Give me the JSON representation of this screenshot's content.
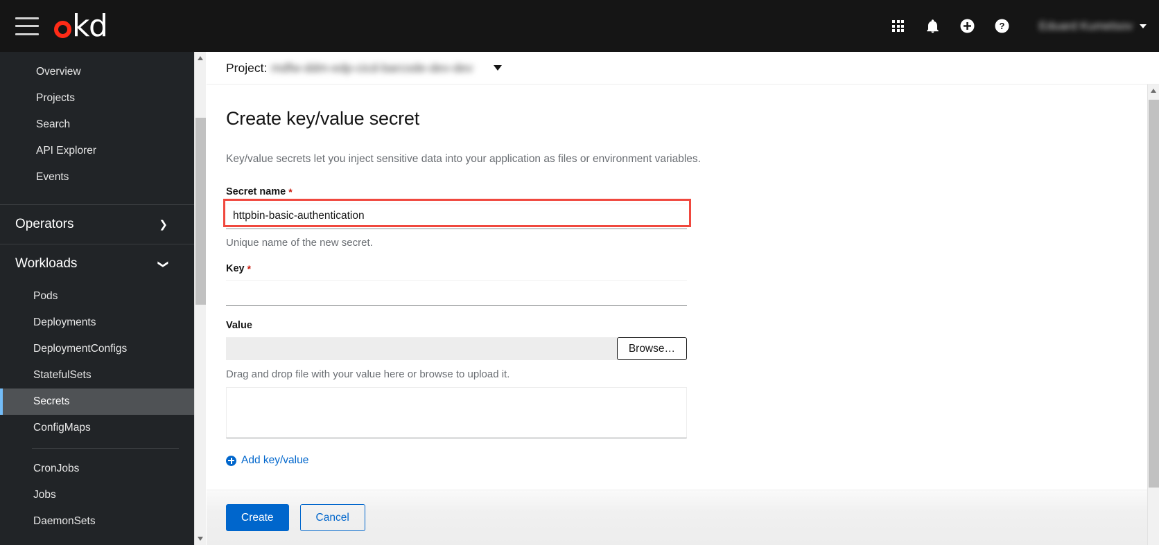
{
  "masthead": {
    "brand": "okd",
    "brand_prefix": "o",
    "brand_suffix": "kd",
    "hamburger_icon": "hamburger-menu-icon",
    "apps_icon": "apps-grid-icon",
    "bell_icon": "notification-bell-icon",
    "plus_icon": "plus-circle-icon",
    "help_icon": "help-circle-icon",
    "user_name": "Eduard Kumetsov",
    "accent_red": "#ff2b17",
    "background": "#151515"
  },
  "sidebar": {
    "items": [
      {
        "label": "Overview",
        "type": "link",
        "active": false
      },
      {
        "label": "Projects",
        "type": "link",
        "active": false
      },
      {
        "label": "Search",
        "type": "link",
        "active": false
      },
      {
        "label": "API Explorer",
        "type": "link",
        "active": false
      },
      {
        "label": "Events",
        "type": "link",
        "active": false
      }
    ],
    "sections": [
      {
        "label": "Operators",
        "expanded": false,
        "chevron": "chevron-right-icon"
      },
      {
        "label": "Workloads",
        "expanded": true,
        "chevron": "chevron-down-icon"
      }
    ],
    "workloads_items": [
      {
        "label": "Pods",
        "active": false
      },
      {
        "label": "Deployments",
        "active": false
      },
      {
        "label": "DeploymentConfigs",
        "active": false
      },
      {
        "label": "StatefulSets",
        "active": false
      },
      {
        "label": "Secrets",
        "active": true
      },
      {
        "label": "ConfigMaps",
        "active": false
      }
    ],
    "workloads_items_group2": [
      {
        "label": "CronJobs",
        "active": false
      },
      {
        "label": "Jobs",
        "active": false
      },
      {
        "label": "DaemonSets",
        "active": false
      }
    ],
    "active_accent": "#73bcf7",
    "background": "#212427"
  },
  "project_bar": {
    "label": "Project:",
    "value": "mdfw-ddm-edp-cicd-barcode-dev-dev",
    "caret_icon": "caret-down-icon"
  },
  "page": {
    "title": "Create key/value secret",
    "description": "Key/value secrets let you inject sensitive data into your application as files or environment variables."
  },
  "form": {
    "secret_name": {
      "label": "Secret name",
      "required_marker": "*",
      "value": "httpbin-basic-authentication",
      "placeholder": "",
      "help": "Unique name of the new secret.",
      "highlight_color": "#f0483e"
    },
    "key": {
      "label": "Key",
      "required_marker": "*",
      "value": "",
      "placeholder": ""
    },
    "value": {
      "label": "Value",
      "browse_label": "Browse…",
      "file_value": "",
      "help": "Drag and drop file with your value here or browse to upload it.",
      "textarea_value": "",
      "textarea_placeholder": ""
    },
    "add_link": {
      "label": "Add key/value",
      "icon": "plus-circle-icon",
      "color": "#06c"
    }
  },
  "footer": {
    "create_label": "Create",
    "cancel_label": "Cancel",
    "primary_color": "#06c"
  }
}
